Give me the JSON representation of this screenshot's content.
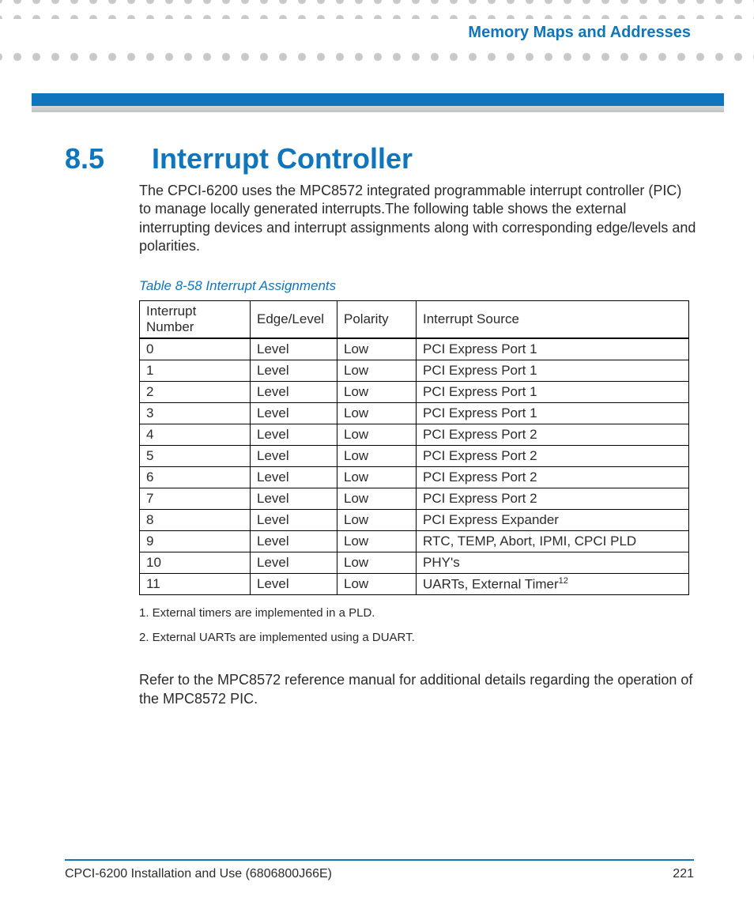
{
  "chapter_title": "Memory Maps and Addresses",
  "section": {
    "number": "8.5",
    "title": "Interrupt Controller",
    "intro": "The CPCI-6200 uses the MPC8572 integrated programmable interrupt controller (PIC) to manage locally generated interrupts.The following table shows the  external interrupting devices and interrupt assignments along with corresponding edge/levels and polarities.",
    "closing": "Refer to the MPC8572 reference manual for additional details regarding the operation of the MPC8572 PIC."
  },
  "table": {
    "caption": "Table 8-58 Interrupt Assignments",
    "headers": {
      "num": "Interrupt Number",
      "edge": "Edge/Level",
      "pol": "Polarity",
      "src": "Interrupt Source"
    },
    "rows": [
      {
        "num": "0",
        "edge": "Level",
        "pol": "Low",
        "src": "PCI Express Port 1",
        "sup": ""
      },
      {
        "num": "1",
        "edge": "Level",
        "pol": "Low",
        "src": "PCI Express Port 1",
        "sup": ""
      },
      {
        "num": "2",
        "edge": "Level",
        "pol": "Low",
        "src": "PCI Express Port 1",
        "sup": ""
      },
      {
        "num": "3",
        "edge": "Level",
        "pol": "Low",
        "src": "PCI Express Port 1",
        "sup": ""
      },
      {
        "num": "4",
        "edge": "Level",
        "pol": "Low",
        "src": "PCI Express Port 2",
        "sup": ""
      },
      {
        "num": "5",
        "edge": "Level",
        "pol": "Low",
        "src": "PCI Express Port 2",
        "sup": ""
      },
      {
        "num": "6",
        "edge": "Level",
        "pol": "Low",
        "src": "PCI Express Port 2",
        "sup": ""
      },
      {
        "num": "7",
        "edge": "Level",
        "pol": "Low",
        "src": "PCI Express Port 2",
        "sup": ""
      },
      {
        "num": "8",
        "edge": "Level",
        "pol": "Low",
        "src": "PCI Express Expander",
        "sup": ""
      },
      {
        "num": "9",
        "edge": "Level",
        "pol": "Low",
        "src": "RTC, TEMP, Abort, IPMI, CPCI PLD",
        "sup": ""
      },
      {
        "num": "10",
        "edge": "Level",
        "pol": "Low",
        "src": "PHY's",
        "sup": ""
      },
      {
        "num": "11",
        "edge": "Level",
        "pol": "Low",
        "src": "UARTs, External Timer",
        "sup": "12"
      }
    ]
  },
  "footnotes": {
    "f1": "1. External timers are implemented in a PLD.",
    "f2": "2. External UARTs are implemented using a DUART."
  },
  "footer": {
    "doc": "CPCI-6200 Installation and Use (6806800J66E)",
    "page": "221"
  }
}
